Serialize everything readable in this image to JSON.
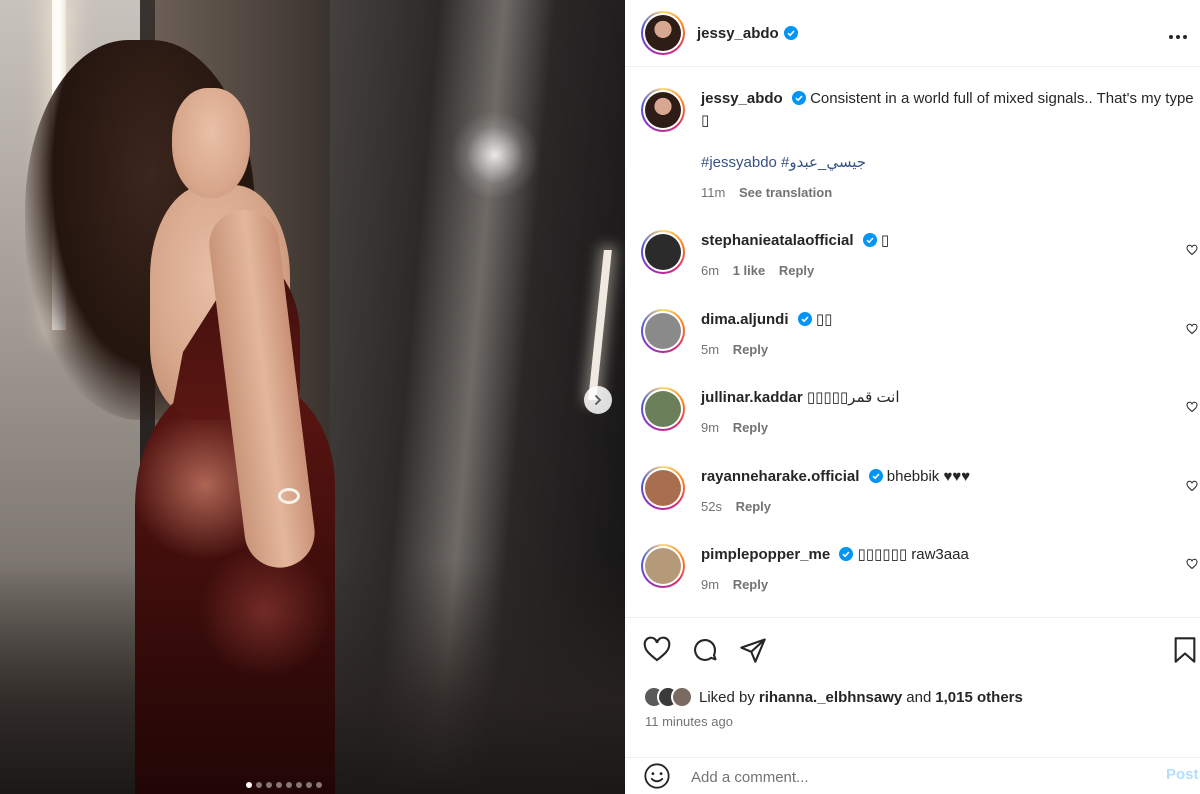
{
  "post": {
    "username": "jessy_abdo",
    "caption": "Consistent in a world full of mixed signals.. That's my type ▯",
    "hashtags": "#jessyabdo #جيسي_عبدو",
    "caption_time": "11m",
    "see_translation": "See translation",
    "carousel_total": 8,
    "carousel_current": 1
  },
  "comments": [
    {
      "username": "stephanieatalaofficial",
      "verified": true,
      "text": "▯",
      "time": "6m",
      "likes": "1 like",
      "reply": "Reply",
      "avatar_color": "#2b2b2b"
    },
    {
      "username": "dima.aljundi",
      "verified": true,
      "text": "▯▯",
      "time": "5m",
      "likes": "",
      "reply": "Reply",
      "avatar_color": "#8a8a8a"
    },
    {
      "username": "jullinar.kaddar",
      "verified": false,
      "text": "▯▯▯▯▯انت قمر",
      "time": "9m",
      "likes": "",
      "reply": "Reply",
      "avatar_color": "#6b7f5a"
    },
    {
      "username": "rayanneharake.official",
      "verified": true,
      "text": "bhebbik ♥♥♥",
      "time": "52s",
      "likes": "",
      "reply": "Reply",
      "avatar_color": "#a86e4e"
    },
    {
      "username": "pimplepopper_me",
      "verified": true,
      "text": "▯▯▯▯▯▯ raw3aaa",
      "time": "9m",
      "likes": "",
      "reply": "Reply",
      "avatar_color": "#b59a7a"
    }
  ],
  "likes": {
    "prefix": "Liked by ",
    "user": "rihanna._elbhnsawy",
    "middle": " and ",
    "others": "1,015 others"
  },
  "time_ago": "11 minutes ago",
  "add_comment": {
    "placeholder": "Add a comment...",
    "post_label": "Post"
  },
  "colors": {
    "verified": "#0095f6",
    "link": "#385185",
    "muted": "#737373",
    "post_disabled": "#b2dffc"
  },
  "icons": [
    "verified-icon",
    "more-icon",
    "chevron-right-icon",
    "heart-icon",
    "comment-icon",
    "share-icon",
    "bookmark-icon",
    "emoji-icon"
  ]
}
